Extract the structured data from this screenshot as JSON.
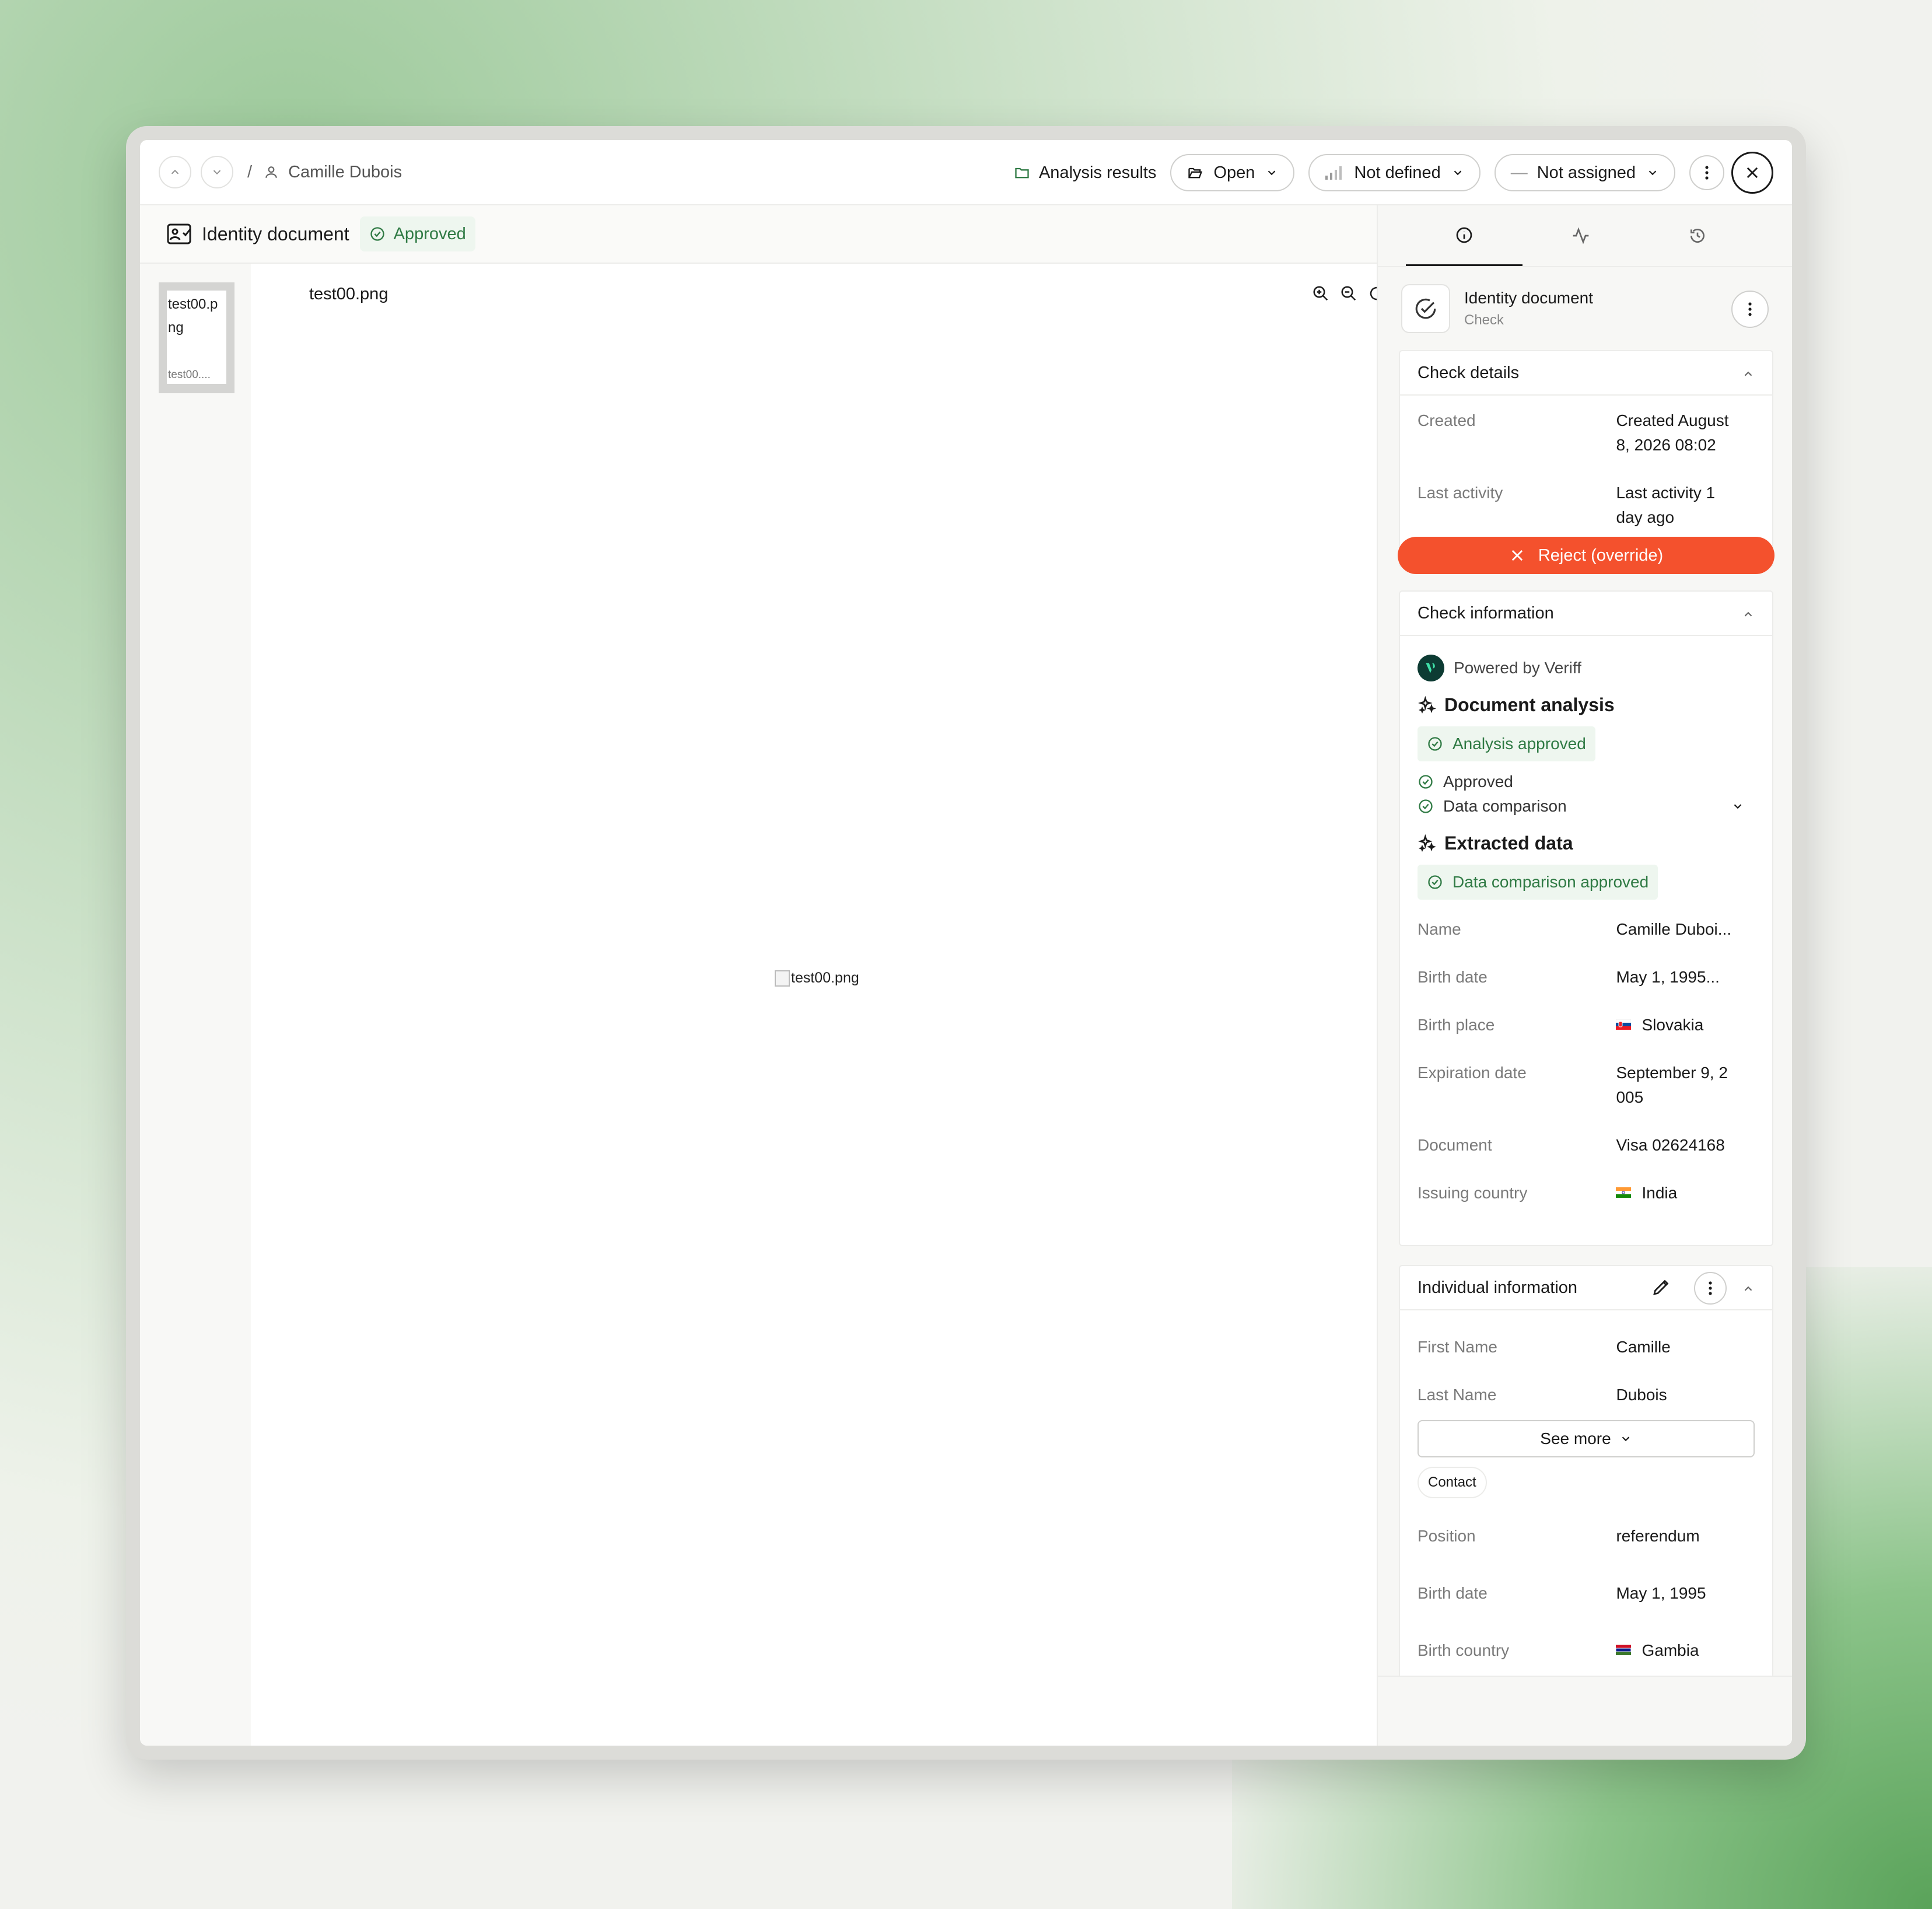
{
  "header": {
    "breadcrumb_sep": "/",
    "person_name": "Camille Dubois",
    "analysis_results": "Analysis results",
    "status_pill": "Open",
    "priority_pill": "Not defined",
    "assignee_pill": "Not assigned",
    "assignee_dash": "—"
  },
  "document": {
    "title": "Identity document",
    "badge": "Approved",
    "thumb_alt": "test00.png",
    "thumb_caption": "test00....",
    "filename": "test00.png",
    "image_alt": "test00.png"
  },
  "panel": {
    "check_title": "Identity document",
    "check_subtitle": "Check",
    "details": {
      "heading": "Check details",
      "created_label": "Created",
      "created_value_1": "Created August",
      "created_value_2": "8, 2026 08:02",
      "activity_label": "Last activity",
      "activity_value_1": "Last activity 1",
      "activity_value_2": "day ago"
    },
    "info": {
      "heading": "Check information",
      "powered": "Powered by Veriff",
      "doc_analysis": "Document analysis",
      "analysis_badge": "Analysis approved",
      "approved": "Approved",
      "data_comparison": "Data comparison",
      "extracted": "Extracted data",
      "comparison_badge": "Data comparison approved",
      "rows": [
        {
          "label": "Name",
          "value": "Camille Duboi..."
        },
        {
          "label": "Birth date",
          "value": "May 1, 1995..."
        },
        {
          "label": "Birth place",
          "value": "Slovakia"
        },
        {
          "label": "Expiration date",
          "value": "September 9, 2",
          "value2": "005"
        },
        {
          "label": "Document",
          "value": "Visa 02624168"
        },
        {
          "label": "Issuing country",
          "value": "India"
        }
      ]
    },
    "individual": {
      "heading": "Individual information",
      "first_label": "First Name",
      "first_value": "Camille",
      "last_label": "Last Name",
      "last_value": "Dubois",
      "see_more": "See more",
      "contact_tag": "Contact",
      "position_label": "Position",
      "position_value": "referendum",
      "birth_label": "Birth date",
      "birth_value": "May 1, 1995",
      "country_label": "Birth country",
      "country_value": "Gambia"
    },
    "reject": "Reject (override)"
  },
  "colors": {
    "accent_green": "#2f7a44",
    "badge_bg": "#eef6ef",
    "reject": "#f4512d"
  },
  "icons": [
    "chevron-up-icon",
    "chevron-down-icon",
    "user-icon",
    "folder-icon",
    "folder-open-icon",
    "signal-bars-icon",
    "more-vertical-icon",
    "close-icon",
    "id-card-icon",
    "check-circle-icon",
    "zoom-in-icon",
    "zoom-out-icon",
    "rotate-cw-icon",
    "rotate-ccw-icon",
    "download-icon",
    "info-icon",
    "activity-icon",
    "history-icon",
    "sparkle-icon",
    "pencil-icon",
    "x-icon"
  ]
}
